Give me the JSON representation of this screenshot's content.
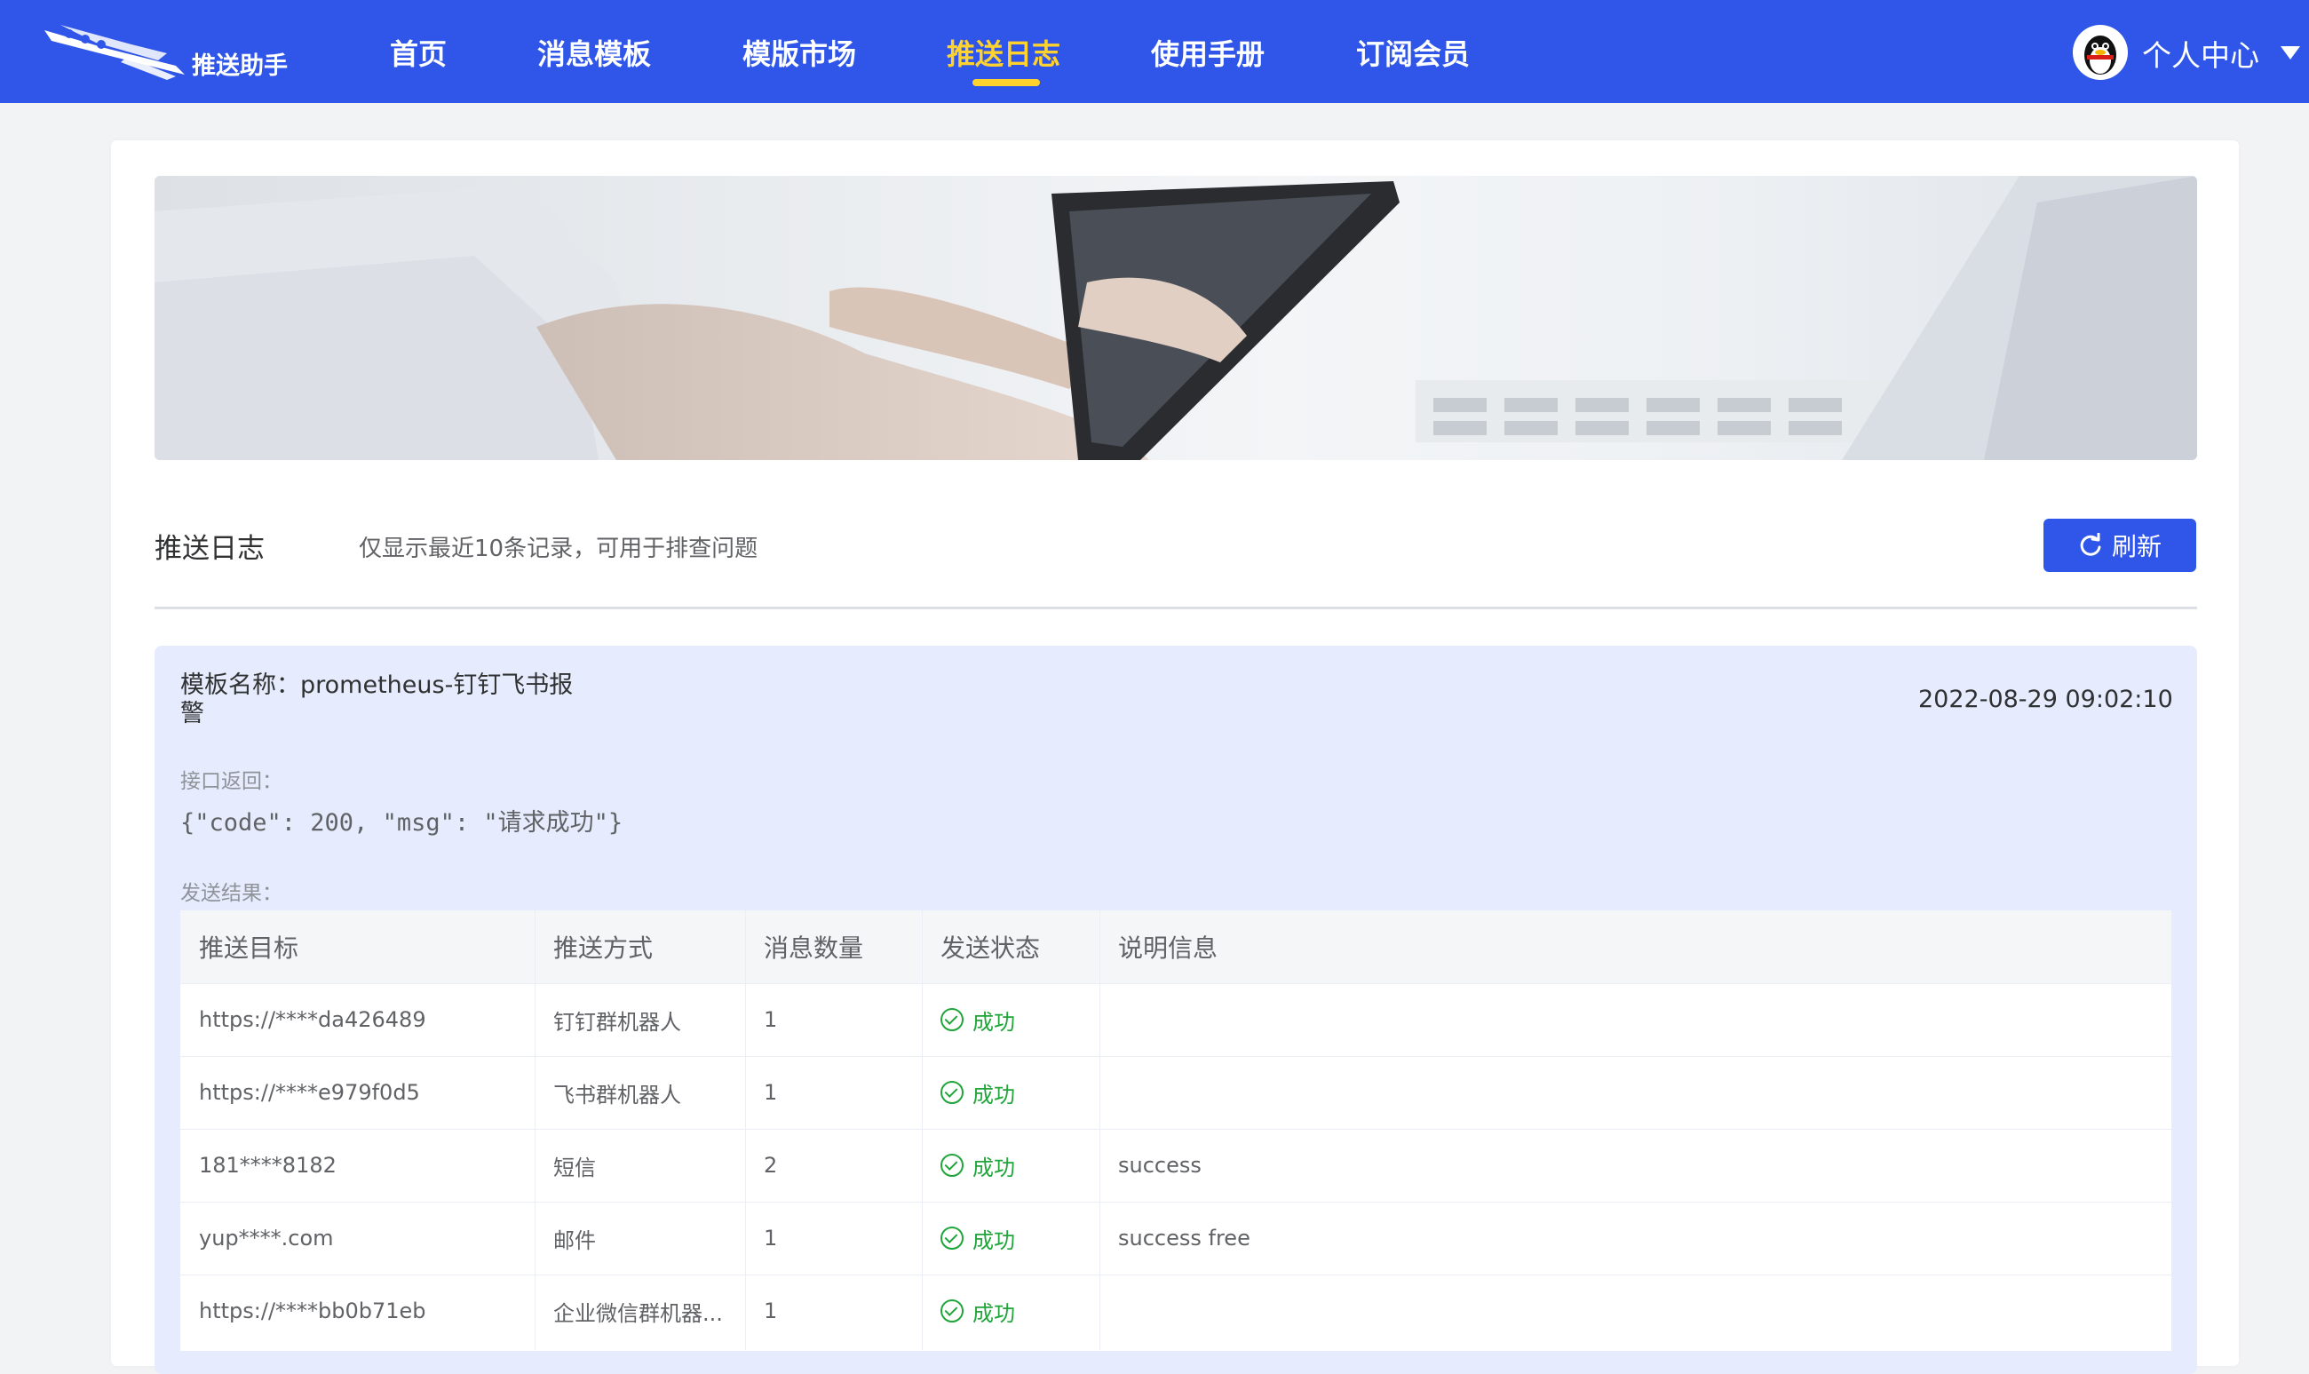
{
  "app": {
    "logo_text": "推送助手"
  },
  "nav": {
    "items": [
      {
        "label": "首页"
      },
      {
        "label": "消息模板"
      },
      {
        "label": "模版市场"
      },
      {
        "label": "推送日志",
        "active": true
      },
      {
        "label": "使用手册"
      },
      {
        "label": "订阅会员"
      }
    ]
  },
  "user": {
    "label": "个人中心"
  },
  "page": {
    "title": "推送日志",
    "description": "仅显示最近10条记录，可用于排查问题",
    "refresh_label": "刷新"
  },
  "log": {
    "template_name": "模板名称：prometheus-钉钉飞书报警",
    "time": "2022-08-29 09:02:10",
    "api_return_label": "接口返回：",
    "api_return": "{\"code\": 200, \"msg\": \"请求成功\"}",
    "result_label": "发送结果：",
    "table": {
      "headers": [
        "推送目标",
        "推送方式",
        "消息数量",
        "发送状态",
        "说明信息"
      ],
      "rows": [
        {
          "target": "https://****da426489",
          "method": "钉钉群机器人",
          "count": "1",
          "status": "成功",
          "info": ""
        },
        {
          "target": "https://****e979f0d5",
          "method": "飞书群机器人",
          "count": "1",
          "status": "成功",
          "info": ""
        },
        {
          "target": "181****8182",
          "method": "短信",
          "count": "2",
          "status": "成功",
          "info": "success"
        },
        {
          "target": "yup****.com",
          "method": "邮件",
          "count": "1",
          "status": "成功",
          "info": "success free"
        },
        {
          "target": "https://****bb0b71eb",
          "method": "企业微信群机器...",
          "count": "1",
          "status": "成功",
          "info": ""
        }
      ]
    }
  },
  "colors": {
    "primary": "#2f56e8",
    "active_nav": "#ffd22e",
    "success": "#20a53a",
    "log_bg": "#e6ecfd"
  }
}
